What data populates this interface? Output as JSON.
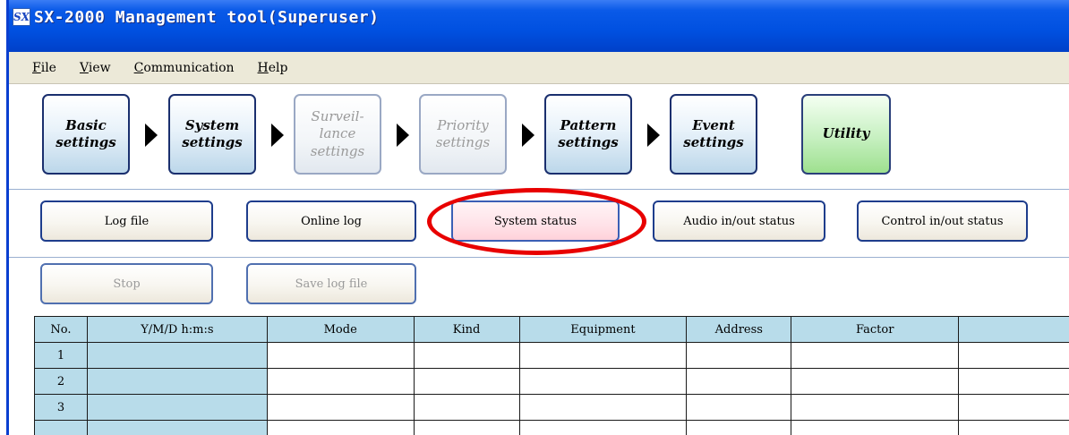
{
  "window": {
    "title": "SX-2000 Management tool(Superuser)",
    "icon_text": "SX"
  },
  "menu": {
    "items": [
      {
        "underline": "F",
        "rest": "ile"
      },
      {
        "underline": "V",
        "rest": "iew"
      },
      {
        "underline": "C",
        "rest": "ommunication"
      },
      {
        "underline": "H",
        "rest": "elp"
      }
    ]
  },
  "workflow": {
    "steps": [
      {
        "lines": [
          "Basic",
          "settings"
        ],
        "state": "enabled"
      },
      {
        "lines": [
          "System",
          "settings"
        ],
        "state": "enabled"
      },
      {
        "lines": [
          "Surveil-",
          "lance",
          "settings"
        ],
        "state": "disabled"
      },
      {
        "lines": [
          "Priority",
          "settings"
        ],
        "state": "disabled"
      },
      {
        "lines": [
          "Pattern",
          "settings"
        ],
        "state": "enabled"
      },
      {
        "lines": [
          "Event",
          "settings"
        ],
        "state": "enabled"
      },
      {
        "lines": [
          "Utility"
        ],
        "state": "active"
      }
    ]
  },
  "utility_buttons": {
    "log_file": "Log file",
    "online_log": "Online log",
    "system_status": "System status",
    "audio_status": "Audio in/out status",
    "control_status": "Control in/out status"
  },
  "log_buttons": {
    "stop": "Stop",
    "save_log": "Save log file"
  },
  "colors": {
    "highlight": "#e80000",
    "active_step": "#9ee08f",
    "header_fill": "#b8dcea"
  },
  "table": {
    "headers": [
      "No.",
      "Y/M/D h:m:s",
      "Mode",
      "Kind",
      "Equipment",
      "Address",
      "Factor",
      ""
    ],
    "rows": [
      [
        "1",
        "",
        "",
        "",
        "",
        "",
        "",
        ""
      ],
      [
        "2",
        "",
        "",
        "",
        "",
        "",
        "",
        ""
      ],
      [
        "3",
        "",
        "",
        "",
        "",
        "",
        "",
        ""
      ],
      [
        "",
        "",
        "",
        "",
        "",
        "",
        "",
        ""
      ]
    ]
  }
}
